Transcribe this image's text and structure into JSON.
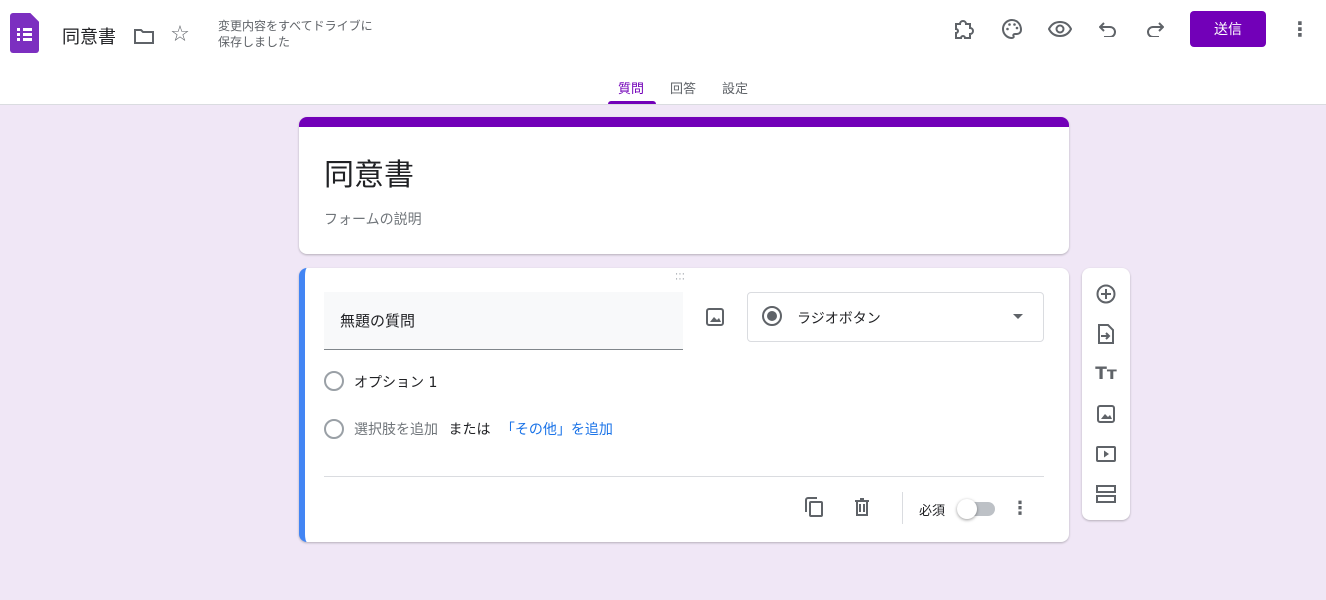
{
  "header": {
    "doc_title": "同意書",
    "save_status_line1": "変更内容をすべてドライブに",
    "save_status_line2": "保存しました",
    "send_label": "送信"
  },
  "tabs": [
    {
      "label": "質問",
      "active": true
    },
    {
      "label": "回答"
    },
    {
      "label": "設定"
    }
  ],
  "form": {
    "title": "同意書",
    "description_placeholder": "フォームの説明"
  },
  "question": {
    "title": "無題の質問",
    "type": "ラジオボタン",
    "option1": "オプション 1",
    "add_option": "選択肢を追加",
    "or": "または",
    "add_other": "「その他」を追加",
    "required_label": "必須",
    "required": false
  },
  "colors": {
    "accent": "#7200b8",
    "question_border": "#4285f4",
    "background": "#f0e7f6"
  }
}
